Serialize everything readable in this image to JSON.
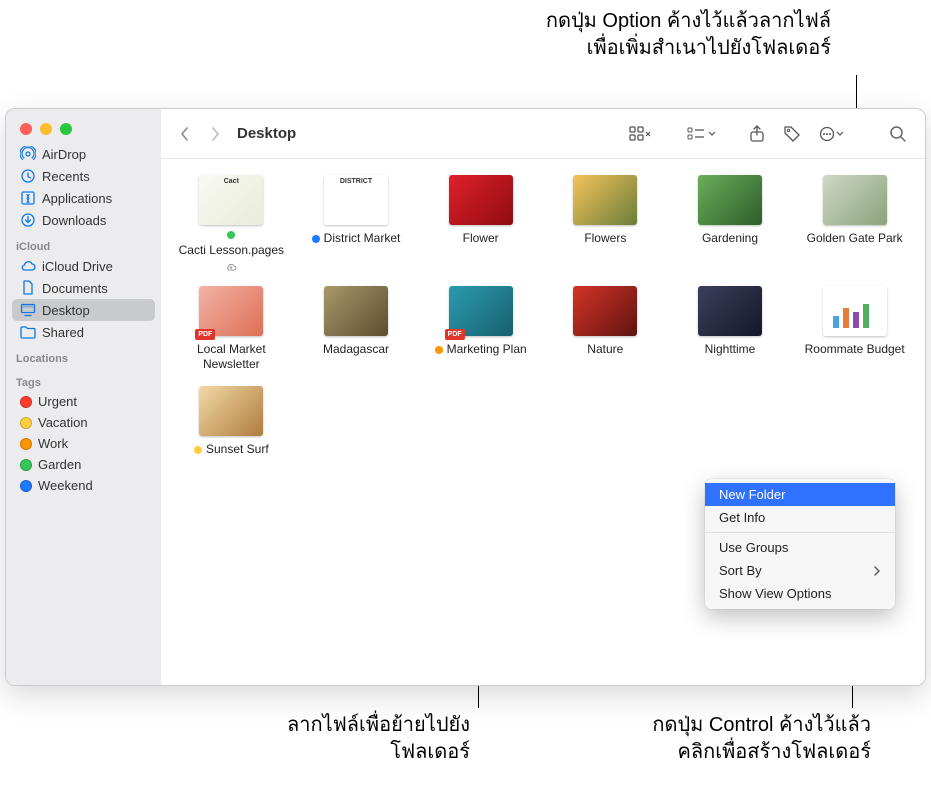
{
  "callouts": {
    "top": {
      "line1": "กดปุ่ม Option ค้างไว้แล้วลากไฟล์",
      "line2": "เพื่อเพิ่มสำเนาไปยังโฟลเดอร์"
    },
    "bottom_left": {
      "line1": "ลากไฟล์เพื่อย้ายไปยัง",
      "line2": "โฟลเดอร์"
    },
    "bottom_right": {
      "line1": "กดปุ่ม Control ค้างไว้แล้ว",
      "line2": "คลิกเพื่อสร้างโฟลเดอร์"
    }
  },
  "window_title": "Desktop",
  "sidebar": {
    "favorites": [
      {
        "icon": "airdrop",
        "label": "AirDrop"
      },
      {
        "icon": "recents",
        "label": "Recents"
      },
      {
        "icon": "apps",
        "label": "Applications"
      },
      {
        "icon": "downloads",
        "label": "Downloads"
      }
    ],
    "icloud_label": "iCloud",
    "icloud": [
      {
        "icon": "cloud",
        "label": "iCloud Drive"
      },
      {
        "icon": "doc",
        "label": "Documents"
      },
      {
        "icon": "desktop",
        "label": "Desktop",
        "selected": true
      },
      {
        "icon": "shared",
        "label": "Shared"
      }
    ],
    "locations_label": "Locations",
    "tags_label": "Tags",
    "tags": [
      {
        "color": "#ff3b30",
        "label": "Urgent"
      },
      {
        "color": "#ffcf3f",
        "label": "Vacation"
      },
      {
        "color": "#ff9500",
        "label": "Work"
      },
      {
        "color": "#34c759",
        "label": "Garden"
      },
      {
        "color": "#1e7aff",
        "label": "Weekend"
      }
    ]
  },
  "files": [
    {
      "name": "Cacti Lesson.pages",
      "tag": "#34c759",
      "cloud": true,
      "thumb": "linear-gradient(135deg,#f9f9f3,#e8ecd8)",
      "badge_text": "Cact"
    },
    {
      "name": "District Market",
      "tag": "#1e7aff",
      "thumb": "linear-gradient(#fff,#fff)",
      "badge_text": "DISTRICT"
    },
    {
      "name": "Flower",
      "thumb": "linear-gradient(135deg,#e0202a,#8f0c10)"
    },
    {
      "name": "Flowers",
      "thumb": "linear-gradient(135deg,#f4c35a,#6b7d3a)"
    },
    {
      "name": "Gardening",
      "thumb": "linear-gradient(135deg,#6aad5a,#2d5e2a)"
    },
    {
      "name": "Golden Gate Park",
      "thumb": "linear-gradient(135deg,#cfd8c6,#8aa37a)"
    },
    {
      "name": "Local Market Newsletter",
      "thumb": "linear-gradient(135deg,#f3b3a6,#de6f55)",
      "pdf": true
    },
    {
      "name": "Madagascar",
      "thumb": "linear-gradient(135deg,#a8986b,#5d4d2f)"
    },
    {
      "name": "Marketing Plan",
      "tag": "#ff9500",
      "thumb": "linear-gradient(135deg,#2a9bb0,#18606e)",
      "pdf": true
    },
    {
      "name": "Nature",
      "thumb": "linear-gradient(135deg,#d43327,#5e1410)"
    },
    {
      "name": "Nighttime",
      "thumb": "linear-gradient(135deg,#3a3f5c,#15182a)"
    },
    {
      "name": "Roommate Budget",
      "thumb": "linear-gradient(#fff,#fff)",
      "chart": true
    },
    {
      "name": "Sunset Surf",
      "tag": "#ffcf3f",
      "thumb": "linear-gradient(135deg,#f2d9a7,#b07c3d)"
    }
  ],
  "context_menu": {
    "items": [
      {
        "label": "New Folder",
        "highlight": true
      },
      {
        "label": "Get Info"
      },
      {
        "sep": true
      },
      {
        "label": "Use Groups"
      },
      {
        "label": "Sort By",
        "submenu": true
      },
      {
        "label": "Show View Options"
      }
    ]
  }
}
